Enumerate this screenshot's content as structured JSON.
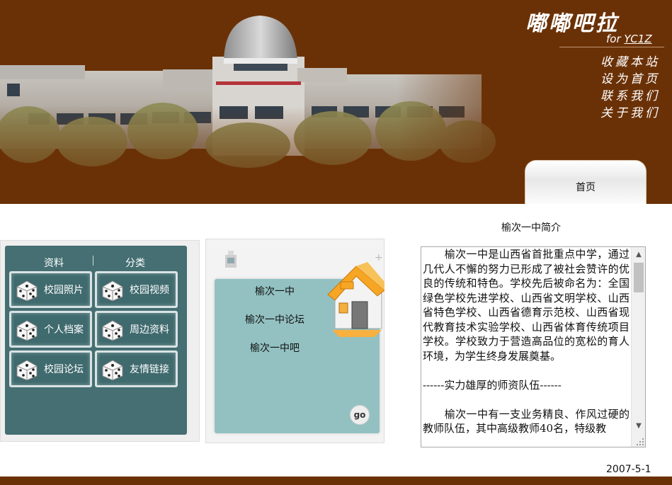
{
  "header": {
    "brand_title": "嘟嘟吧拉",
    "brand_sub_prefix": "for ",
    "brand_sub_mark": "YC1Z",
    "quick_links": [
      "收藏本站",
      "设为首页",
      "联系我们",
      "关于我们"
    ],
    "home_tab": "首页"
  },
  "categories": {
    "header_left": "资料",
    "header_right": "分类",
    "items": [
      {
        "label": "校园照片"
      },
      {
        "label": "校园视频"
      },
      {
        "label": "个人档案"
      },
      {
        "label": "周边资料"
      },
      {
        "label": "校园论坛"
      },
      {
        "label": "友情链接"
      }
    ]
  },
  "links": {
    "items": [
      "榆次一中",
      "榆次一中论坛",
      "榆次一中吧"
    ],
    "go_label": "go"
  },
  "intro": {
    "title": "榆次一中简介",
    "paragraph1": "　　榆次一中是山西省首批重点中学，通过几代人不懈的努力已形成了被社会赞许的优良的传统和特色。学校先后被命名为：全国绿色学校先进学校、山西省文明学校、山西省特色学校、山西省德育示范校、山西省现代教育技术实验学校、山西省体育传统项目学校。学校致力于营造高品位的宽松的育人环境，为学生终身发展奠基。",
    "section_heading": "------实力雄厚的师资队伍------",
    "paragraph2": "　　榆次一中有一支业务精良、作风过硬的教师队伍，其中高级教师40名，特级教"
  },
  "footer": {
    "date": "2007-5-1"
  },
  "colors": {
    "header_brown": "#6b3106",
    "panel_teal": "#456f72",
    "links_teal": "#93c1c1"
  }
}
